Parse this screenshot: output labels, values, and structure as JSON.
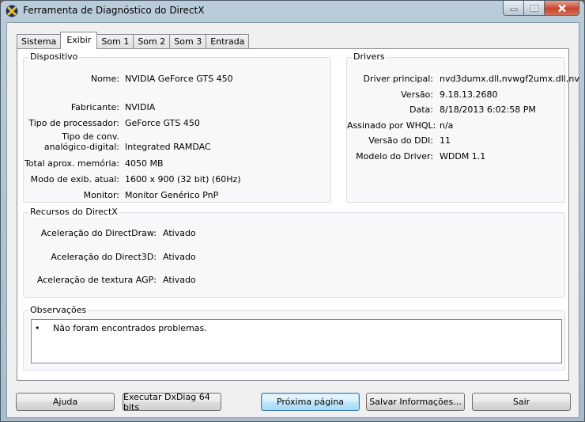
{
  "window": {
    "title": "Ferramenta de Diagnóstico do DirectX"
  },
  "tabs": [
    {
      "label": "Sistema",
      "active": false
    },
    {
      "label": "Exibir",
      "active": true
    },
    {
      "label": "Som 1",
      "active": false
    },
    {
      "label": "Som 2",
      "active": false
    },
    {
      "label": "Som 3",
      "active": false
    },
    {
      "label": "Entrada",
      "active": false
    }
  ],
  "device": {
    "label": "Dispositivo",
    "fields": [
      {
        "key": "Nome:",
        "value": "NVIDIA GeForce GTS 450"
      },
      {
        "key": "Fabricante:",
        "value": "NVIDIA"
      },
      {
        "key": "Tipo de processador:",
        "value": "GeForce GTS 450"
      },
      {
        "key": "Tipo de conv.",
        "key2": "analógico-digital:",
        "value": "Integrated RAMDAC"
      },
      {
        "key": "Total aprox. memória:",
        "value": "4050 MB"
      },
      {
        "key": "Modo de exib. atual:",
        "value": "1600 x 900 (32 bit) (60Hz)"
      },
      {
        "key": "Monitor:",
        "value": "Monitor Genérico PnP"
      }
    ]
  },
  "drivers": {
    "label": "Drivers",
    "fields": [
      {
        "key": "Driver principal:",
        "value": "nvd3dumx.dll,nvwgf2umx.dll,nv"
      },
      {
        "key": "Versão:",
        "value": "9.18.13.2680"
      },
      {
        "key": "Data:",
        "value": "8/18/2013 6:02:58 PM"
      },
      {
        "key": "Assinado por WHQL:",
        "value": "n/a"
      },
      {
        "key": "Versão do DDI:",
        "value": "11"
      },
      {
        "key": "Modelo do Driver:",
        "value": "WDDM 1.1"
      }
    ]
  },
  "directx": {
    "label": "Recursos do DirectX",
    "fields": [
      {
        "key": "Aceleração do DirectDraw:",
        "value": "Ativado"
      },
      {
        "key": "Aceleração do Direct3D:",
        "value": "Ativado"
      },
      {
        "key": "Aceleração de textura AGP:",
        "value": "Ativado"
      }
    ]
  },
  "notes": {
    "label": "Observações",
    "bullet": "•",
    "items": [
      "Não foram encontrados problemas."
    ]
  },
  "buttons": {
    "help": "Ajuda",
    "run64": "Executar DxDiag 64 bits",
    "next": "Próxima página",
    "save": "Salvar Informações...",
    "exit": "Sair"
  },
  "colors": {
    "close_button": "#c7452d",
    "default_button_border": "#3c7fb1"
  },
  "icons": {
    "app": "directx-x-icon",
    "minimize": "minimize-icon",
    "maximize": "maximize-icon",
    "close": "close-icon"
  }
}
